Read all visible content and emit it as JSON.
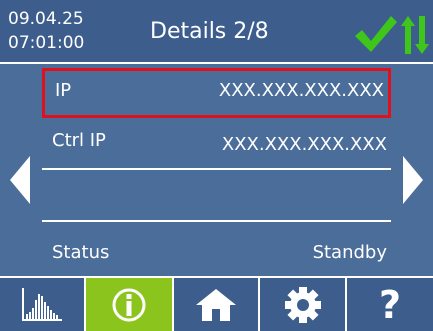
{
  "header": {
    "date": "09.04.25",
    "time": "07:01:00",
    "title": "Details 2/8",
    "status_icons": [
      "checkmark-icon",
      "updown-arrows-icon"
    ],
    "status_color": "#3ec61a"
  },
  "rows": [
    {
      "label": "IP",
      "value": "XXX.XXX.XXX.XXX",
      "selected": true
    },
    {
      "label": "Ctrl IP",
      "value": "XXX.XXX.XXX.XXX",
      "selected": false
    },
    {
      "label": "",
      "value": "",
      "selected": false
    },
    {
      "label": "Status",
      "value": "Standby",
      "selected": false
    }
  ],
  "navigation": {
    "left_icon": "triangle-left-icon",
    "right_icon": "triangle-right-icon"
  },
  "toolbar": {
    "buttons": [
      {
        "icon": "bar-chart-icon",
        "active": false
      },
      {
        "icon": "info-icon",
        "active": true
      },
      {
        "icon": "home-icon",
        "active": false
      },
      {
        "icon": "gear-icon",
        "active": false
      },
      {
        "icon": "question-icon",
        "label": "?",
        "active": false
      }
    ]
  },
  "colors": {
    "background": "#4b6d99",
    "header": "#3d5e8d",
    "active_button": "#8cc41e",
    "selection_border": "#e0101c"
  }
}
